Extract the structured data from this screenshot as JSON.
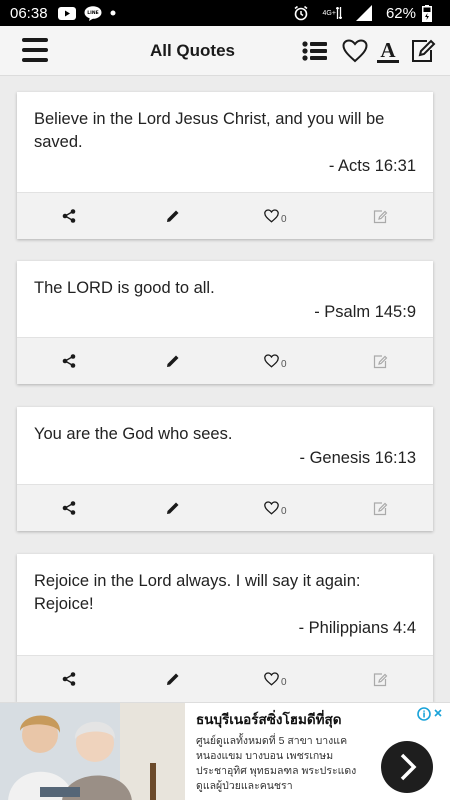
{
  "status": {
    "time": "06:38",
    "network": "4G+",
    "battery": "62%"
  },
  "header": {
    "title": "All Quotes"
  },
  "quotes": [
    {
      "text": "Believe in the Lord Jesus Christ, and you will be saved.",
      "ref": "- Acts 16:31",
      "likes": "0"
    },
    {
      "text": "The LORD is good to all.",
      "ref": "- Psalm 145:9",
      "likes": "0"
    },
    {
      "text": "You are the God who sees.",
      "ref": "- Genesis 16:13",
      "likes": "0"
    },
    {
      "text": "Rejoice in the Lord always. I will say it again: Rejoice!",
      "ref": "- Philippians 4:4",
      "likes": "0"
    }
  ],
  "ad": {
    "title": "ธนบุรีเนอร์สซิ่งโฮมดีที่สุด",
    "description": "ศูนย์ดูแลทั้งหมดที่ 5 สาขา บางแค หนองแขม บางบอน เพชรเกษม ประชาอุทิศ พุทธมลฑล พระประแดง ดูแลผู้ป่วยและคนชรา"
  },
  "colors": {
    "statusbar": "#000000",
    "appbar": "#f5f5f5",
    "background": "#ececec",
    "card": "#ffffff",
    "action_bar": "#f2f2f2"
  }
}
